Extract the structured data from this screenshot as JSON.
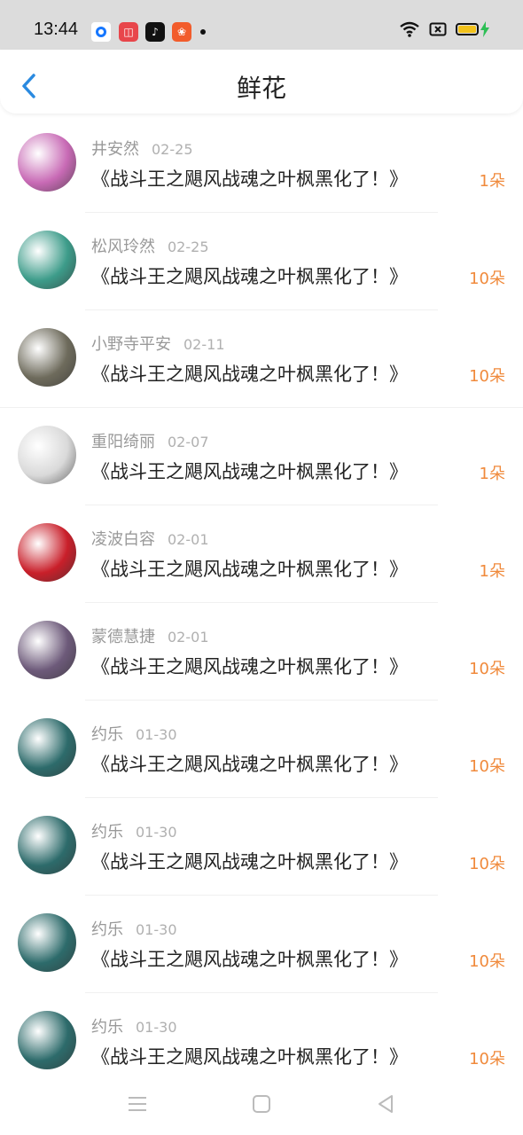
{
  "status": {
    "time": "13:44"
  },
  "header": {
    "title": "鲜花"
  },
  "entries": [
    {
      "name": "井安然",
      "date": "02-25",
      "book": "《战斗王之飓风战魂之叶枫黑化了！》",
      "count": "1朵",
      "avatar_color": "#c86ab5"
    },
    {
      "name": "松风玲然",
      "date": "02-25",
      "book": "《战斗王之飓风战魂之叶枫黑化了！》",
      "count": "10朵",
      "avatar_color": "#3d9c8a"
    },
    {
      "name": "小野寺平安",
      "date": "02-11",
      "book": "《战斗王之飓风战魂之叶枫黑化了！》",
      "count": "10朵",
      "avatar_color": "#6e6b5c"
    },
    {
      "name": "重阳绮丽",
      "date": "02-07",
      "book": "《战斗王之飓风战魂之叶枫黑化了！》",
      "count": "1朵",
      "avatar_color": "#d9d9d9"
    },
    {
      "name": "凌波白容",
      "date": "02-01",
      "book": "《战斗王之飓风战魂之叶枫黑化了！》",
      "count": "1朵",
      "avatar_color": "#c91f2a"
    },
    {
      "name": "蒙德慧捷",
      "date": "02-01",
      "book": "《战斗王之飓风战魂之叶枫黑化了！》",
      "count": "10朵",
      "avatar_color": "#6d5a7a"
    },
    {
      "name": "约乐",
      "date": "01-30",
      "book": "《战斗王之飓风战魂之叶枫黑化了！》",
      "count": "10朵",
      "avatar_color": "#2d6b6b"
    },
    {
      "name": "约乐",
      "date": "01-30",
      "book": "《战斗王之飓风战魂之叶枫黑化了！》",
      "count": "10朵",
      "avatar_color": "#2d6b6b"
    },
    {
      "name": "约乐",
      "date": "01-30",
      "book": "《战斗王之飓风战魂之叶枫黑化了！》",
      "count": "10朵",
      "avatar_color": "#2d6b6b"
    },
    {
      "name": "约乐",
      "date": "01-30",
      "book": "《战斗王之飓风战魂之叶枫黑化了！》",
      "count": "10朵",
      "avatar_color": "#2d6b6b"
    }
  ],
  "colors": {
    "accent": "#2a8ae0",
    "count": "#f08a3c"
  }
}
